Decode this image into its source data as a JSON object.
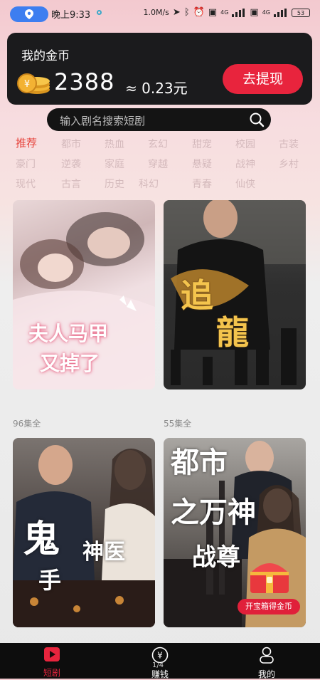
{
  "status_bar": {
    "time": "晚上9:33",
    "speed": "1.0M/s",
    "net1": "4G",
    "net2": "4G",
    "battery": "53"
  },
  "coin_card": {
    "title": "我的金币",
    "amount": "2388",
    "approx_value": "≈ 0.23元",
    "withdraw_label": "去提现"
  },
  "search": {
    "placeholder": "输入剧名搜索短剧"
  },
  "categories": [
    [
      "推荐",
      "都市",
      "热血",
      "玄幻",
      "甜宠",
      "校园",
      "古装"
    ],
    [
      "豪门",
      "逆袭",
      "家庭",
      "穿越",
      "悬疑",
      "战神",
      "乡村"
    ],
    [
      "现代",
      "古言",
      "历史",
      "科幻",
      "青春",
      "仙侠"
    ]
  ],
  "cards": [
    {
      "title_line1": "夫人马甲",
      "title_line2": "又掉了",
      "episodes": ""
    },
    {
      "title_line1": "追",
      "title_line2": "龍",
      "episodes": ""
    },
    {
      "title_line1": "鬼",
      "title_line2": "神医",
      "title_line3": "手",
      "episodes": "96集全"
    },
    {
      "title_line1": "都市",
      "title_line2": "之万神",
      "title_line3": "战尊",
      "episodes": "55集全",
      "badge": "开宝箱得金币"
    }
  ],
  "bottom_nav": {
    "items": [
      {
        "label": "短剧",
        "icon": "play-icon",
        "active": true
      },
      {
        "label": "赚钱",
        "icon": "yuan-coin-icon",
        "active": false
      },
      {
        "label": "我的",
        "icon": "person-icon",
        "active": false
      }
    ],
    "page_indicator": "1/4"
  },
  "colors": {
    "accent": "#e8243d",
    "active_tab": "#e6443c",
    "card_bg": "#1b1b1d"
  }
}
